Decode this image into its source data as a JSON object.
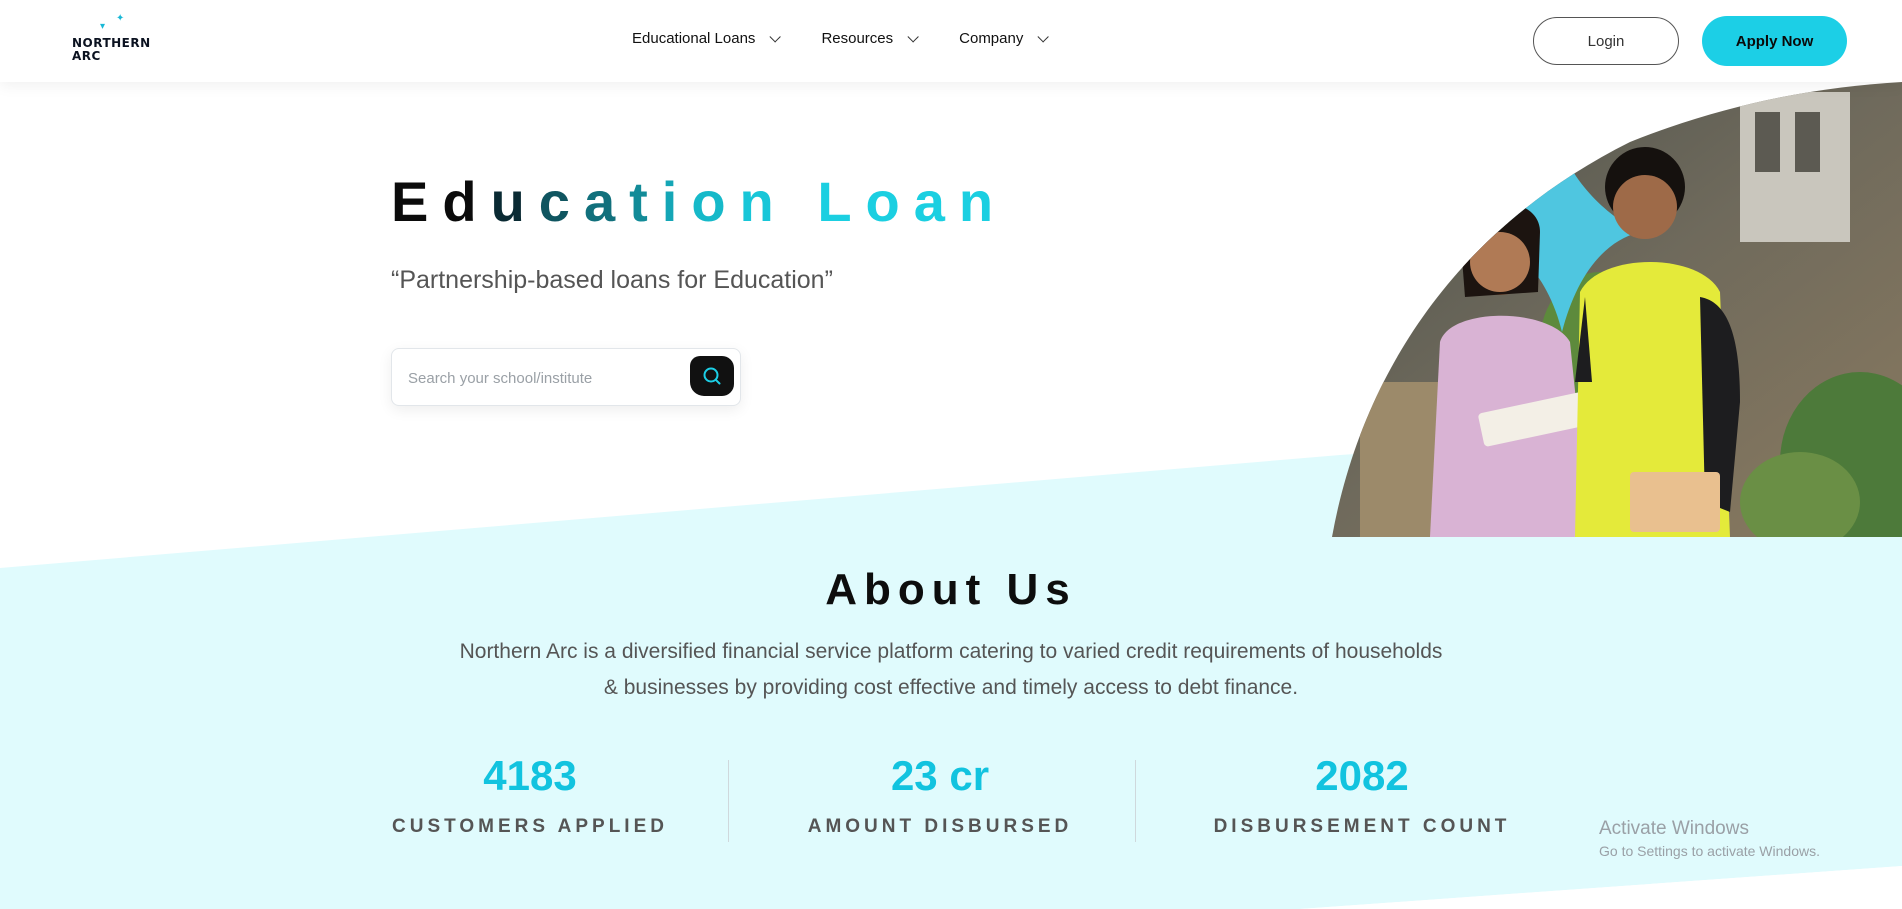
{
  "header": {
    "logo": {
      "line1": "NORTHERN",
      "line2": "ARC"
    },
    "nav": [
      {
        "label": "Educational Loans"
      },
      {
        "label": "Resources"
      },
      {
        "label": "Company"
      }
    ],
    "login_label": "Login",
    "apply_label": "Apply Now"
  },
  "hero": {
    "title_letters": [
      "E",
      "d",
      "u",
      "c",
      "a",
      "t",
      "i",
      "o",
      "n",
      " ",
      "L",
      "o",
      "a",
      "n"
    ],
    "title_colors": [
      "#0b0b0b",
      "#0b0b0b",
      "#0a2a33",
      "#0f5560",
      "#11707c",
      "#128b98",
      "#14a6b6",
      "#16b9c9",
      "#18c6d8",
      "#18c6d8",
      "#1bcfe1",
      "#1bcfe1",
      "#1bcfe1",
      "#1bcfe1"
    ],
    "subtitle": "“Partnership-based loans for Education”",
    "search": {
      "placeholder": "Search your school/institute",
      "value": ""
    }
  },
  "about": {
    "title": "About Us",
    "text": "Northern Arc is a diversified financial service platform catering to varied credit requirements of households & businesses by providing cost effective and timely access to debt finance.",
    "stats": [
      {
        "value": "4183",
        "label": "CUSTOMERS APPLIED"
      },
      {
        "value": "23 cr",
        "label": "AMOUNT DISBURSED"
      },
      {
        "value": "2082",
        "label": "DISBURSEMENT COUNT"
      }
    ]
  },
  "watermark": {
    "line1": "Activate Windows",
    "line2": "Go to Settings to activate Windows."
  },
  "colors": {
    "accent": "#1ccfe6",
    "about_bg": "#e0fbfd",
    "stat_value": "#12c3df"
  }
}
